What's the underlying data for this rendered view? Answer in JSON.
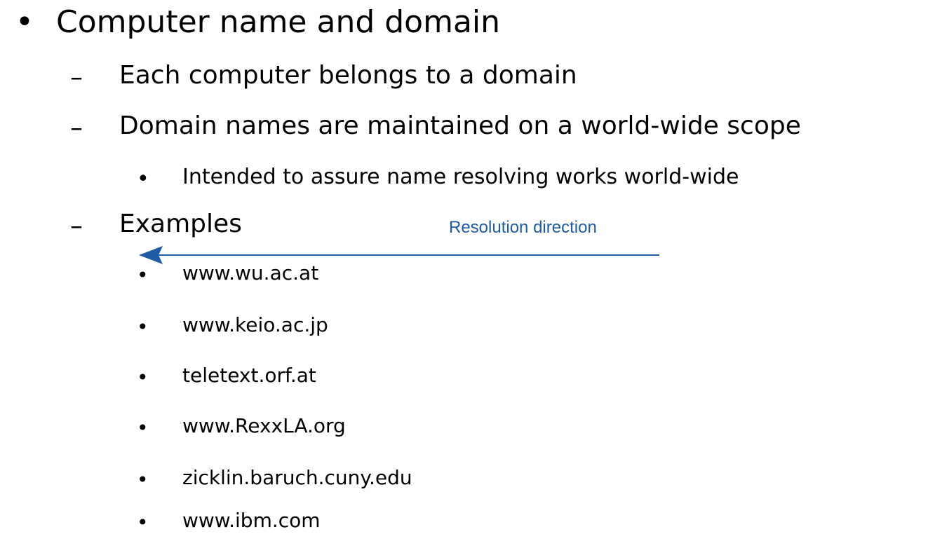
{
  "slide": {
    "heading": {
      "bullet": "•",
      "text": "Computer name and domain"
    },
    "sub_items": [
      {
        "marker": "–",
        "text": "Each computer belongs to a domain"
      },
      {
        "marker": "–",
        "text": "Domain names are maintained on a world-wide scope"
      },
      {
        "marker": "–",
        "text": "Examples"
      }
    ],
    "scope_note": {
      "bullet": "•",
      "text": "Intended to assure name resolving works world-wide"
    },
    "examples": [
      {
        "bullet": "•",
        "text": "www.wu.ac.at"
      },
      {
        "bullet": "•",
        "text": "www.keio.ac.jp"
      },
      {
        "bullet": "•",
        "text": "teletext.orf.at"
      },
      {
        "bullet": "•",
        "text": "www.RexxLA.org"
      },
      {
        "bullet": "•",
        "text": "zicklin.baruch.cuny.edu"
      },
      {
        "bullet": "•",
        "text": "www.ibm.com"
      }
    ],
    "annotation": {
      "text": "Resolution direction",
      "color": "#1f5aa6"
    }
  }
}
